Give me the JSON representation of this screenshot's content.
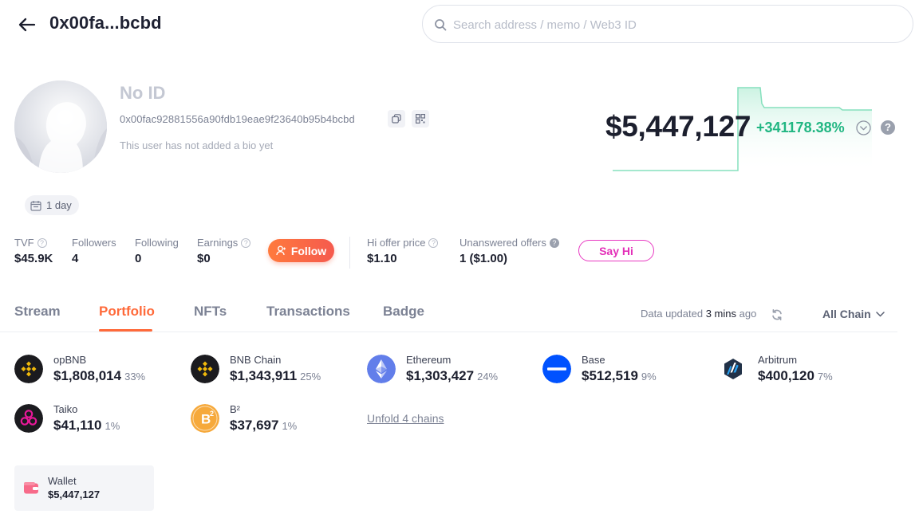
{
  "header": {
    "title": "0x00fa...bcbd",
    "search_placeholder": "Search address / memo / Web3 ID"
  },
  "profile": {
    "name": "No ID",
    "address": "0x00fac92881556a90fdb19eae9f23640b95b4bcbd",
    "bio": "This user has not added a bio yet",
    "age_tag": "1 day"
  },
  "value": {
    "total": "$5,447,127",
    "change": "+341178.38%",
    "change_color": "#21b682"
  },
  "stats": {
    "tvf_label": "TVF",
    "tvf_value": "$45.9K",
    "followers_label": "Followers",
    "followers_value": "4",
    "following_label": "Following",
    "following_value": "0",
    "earnings_label": "Earnings",
    "earnings_value": "$0",
    "follow_button": "Follow",
    "hi_offer_label": "Hi offer price",
    "hi_offer_value": "$1.10",
    "unanswered_label": "Unanswered offers",
    "unanswered_value": "1 ($1.00)",
    "say_hi_button": "Say Hi"
  },
  "tabs": {
    "items": [
      "Stream",
      "Portfolio",
      "NFTs",
      "Transactions",
      "Badge"
    ],
    "active": "Portfolio",
    "accent_color": "#ff6a3a"
  },
  "toolbar": {
    "updated_prefix": "Data updated",
    "updated_time": "3 mins",
    "updated_suffix": "ago",
    "chain_filter": "All Chain"
  },
  "chains": [
    {
      "name": "opBNB",
      "value": "$1,808,014",
      "share": "33%",
      "icon": "bnb-icon"
    },
    {
      "name": "BNB Chain",
      "value": "$1,343,911",
      "share": "25%",
      "icon": "bnb-icon"
    },
    {
      "name": "Ethereum",
      "value": "$1,303,427",
      "share": "24%",
      "icon": "ethereum-icon"
    },
    {
      "name": "Base",
      "value": "$512,519",
      "share": "9%",
      "icon": "base-icon"
    },
    {
      "name": "Arbitrum",
      "value": "$400,120",
      "share": "7%",
      "icon": "arbitrum-icon"
    },
    {
      "name": "Taiko",
      "value": "$41,110",
      "share": "1%",
      "icon": "taiko-icon"
    },
    {
      "name": "B²",
      "value": "$37,697",
      "share": "1%",
      "icon": "b2-icon"
    }
  ],
  "unfold_label": "Unfold 4 chains",
  "wallet": {
    "name": "Wallet",
    "value": "$5,447,127"
  }
}
